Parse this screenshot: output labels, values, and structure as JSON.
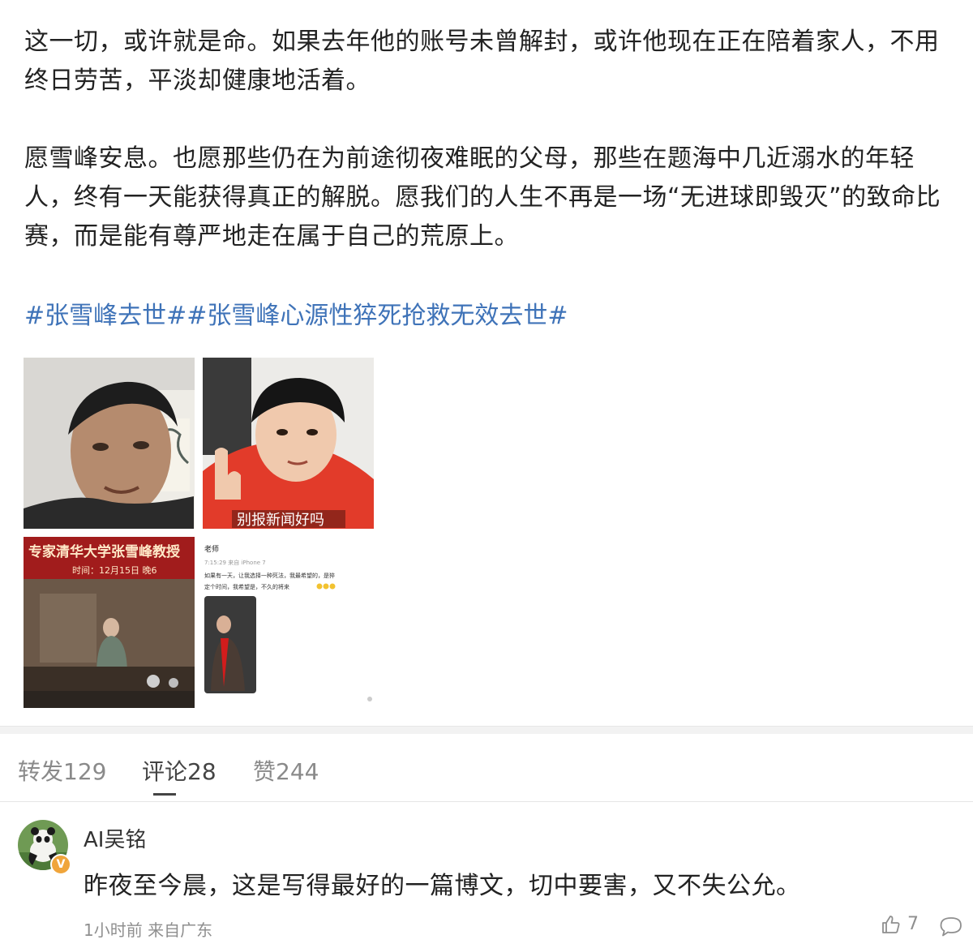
{
  "post": {
    "paragraph_1": "这一切，或许就是命。如果去年他的账号未曾解封，或许他现在正在陪着家人，不用终日劳苦，平淡却健康地活着。",
    "paragraph_2": "愿雪峰安息。也愿那些仍在为前途彻夜难眠的父母，那些在题海中几近溺水的年轻人，终有一天能获得真正的解脱。愿我们的人生不再是一场“无进球即毁灭”的致命比赛，而是能有尊严地走在属于自己的荒原上。",
    "hashtag_1": "#张雪峰去世#",
    "hashtag_2": "#张雪峰心源性猝死抢救无效去世#"
  },
  "images": {
    "img2_caption": "别报新闻好吗",
    "img3_banner": "专家清华大学张雪峰教授",
    "img3_subbanner": "时间：12月15日 晚6",
    "img4_name": "老师",
    "img4_meta": "7:15:29 来自 iPhone 7",
    "img4_text_1": "如果有一天，让我选择一种死法，我最希望的，是猝",
    "img4_text_2": "定个时间，我希望是，不久的将来"
  },
  "tabs": {
    "repost": "转发129",
    "comment": "评论28",
    "like": "赞244"
  },
  "comment": {
    "user": "AI吴铭",
    "badge": "V",
    "text": "昨夜至今晨，这是写得最好的一篇博文，切中要害，又不失公允。",
    "meta": "1小时前 来自广东",
    "like_count": "7"
  },
  "colors": {
    "link": "#3f73b8",
    "text": "#222222",
    "muted": "#8f8f8f",
    "verified": "#f0a53b"
  }
}
